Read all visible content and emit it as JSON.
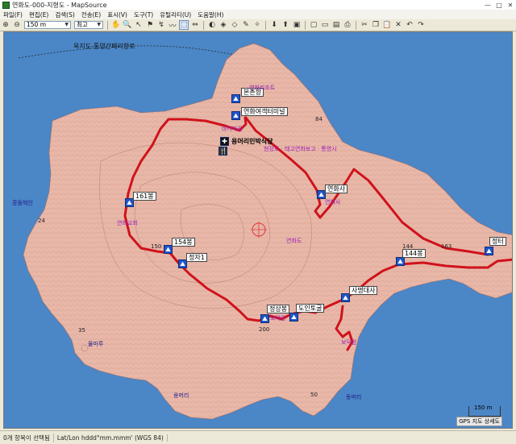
{
  "window": {
    "title": "연화도-000-지형도 - MapSource",
    "min": "—",
    "max": "□",
    "close": "✕"
  },
  "menu": [
    "파일(F)",
    "편집(E)",
    "검색(S)",
    "전송(E)",
    "표시(V)",
    "도구(T)",
    "유틸리티(U)",
    "도움말(H)"
  ],
  "toolbar": {
    "zoom_value": "150 m",
    "detail_value": "최고"
  },
  "map": {
    "route_label": "욕지도-통영간페리항로",
    "sea_labels": {
      "left": "콩돌해안",
      "bottom_left": "물마루",
      "bottom": "용머리",
      "bottom_right": "동머리"
    },
    "contour_labels": [
      "84",
      "24",
      "35",
      "150",
      "163",
      "144",
      "200",
      "50"
    ],
    "waypoints": [
      {
        "id": "wp-ponjeon",
        "text": "본촌항"
      },
      {
        "id": "wp-terminal",
        "text": "연화여객터미널"
      },
      {
        "id": "wp-restaurant",
        "text": "용머리민박식당"
      },
      {
        "id": "wp-temple",
        "text": "연화사"
      },
      {
        "id": "wp-161",
        "text": "161봉"
      },
      {
        "id": "wp-154",
        "text": "154봉"
      },
      {
        "id": "wp-pavilion",
        "text": "정자1"
      },
      {
        "id": "wp-144",
        "text": "144봉"
      },
      {
        "id": "wp-summit",
        "text": "정상봉"
      },
      {
        "id": "wp-bosal",
        "text": "보덕암"
      },
      {
        "id": "wp-toilet",
        "text": "도인토굴"
      },
      {
        "id": "wp-sabeom",
        "text": "사명대사"
      },
      {
        "id": "wp-end",
        "text": "정터"
      }
    ],
    "poi": [
      {
        "id": "poi-resort",
        "text": "연화리조트"
      },
      {
        "id": "poi-market",
        "text": "바다마을"
      },
      {
        "id": "poi-guide",
        "text": "현장도 · 태고연화보고 · 통영시"
      },
      {
        "id": "poi-temple2",
        "text": "연화사"
      },
      {
        "id": "poi-church",
        "text": "연화교회"
      },
      {
        "id": "poi-island",
        "text": "연화도"
      },
      {
        "id": "poi-misc",
        "text": "보덕암"
      }
    ],
    "scale_text": "150 m",
    "style_text": "GPS 지도 상세도"
  },
  "status": {
    "count": "0개 항목이 선택됨",
    "coord": "Lat/Lon hddd°mm.mmm' (WGS 84)"
  },
  "colors": {
    "sea": "#4b86c6",
    "land": "#e7b7a8",
    "track": "#d0121b",
    "waypoint": "#1f55c9"
  }
}
